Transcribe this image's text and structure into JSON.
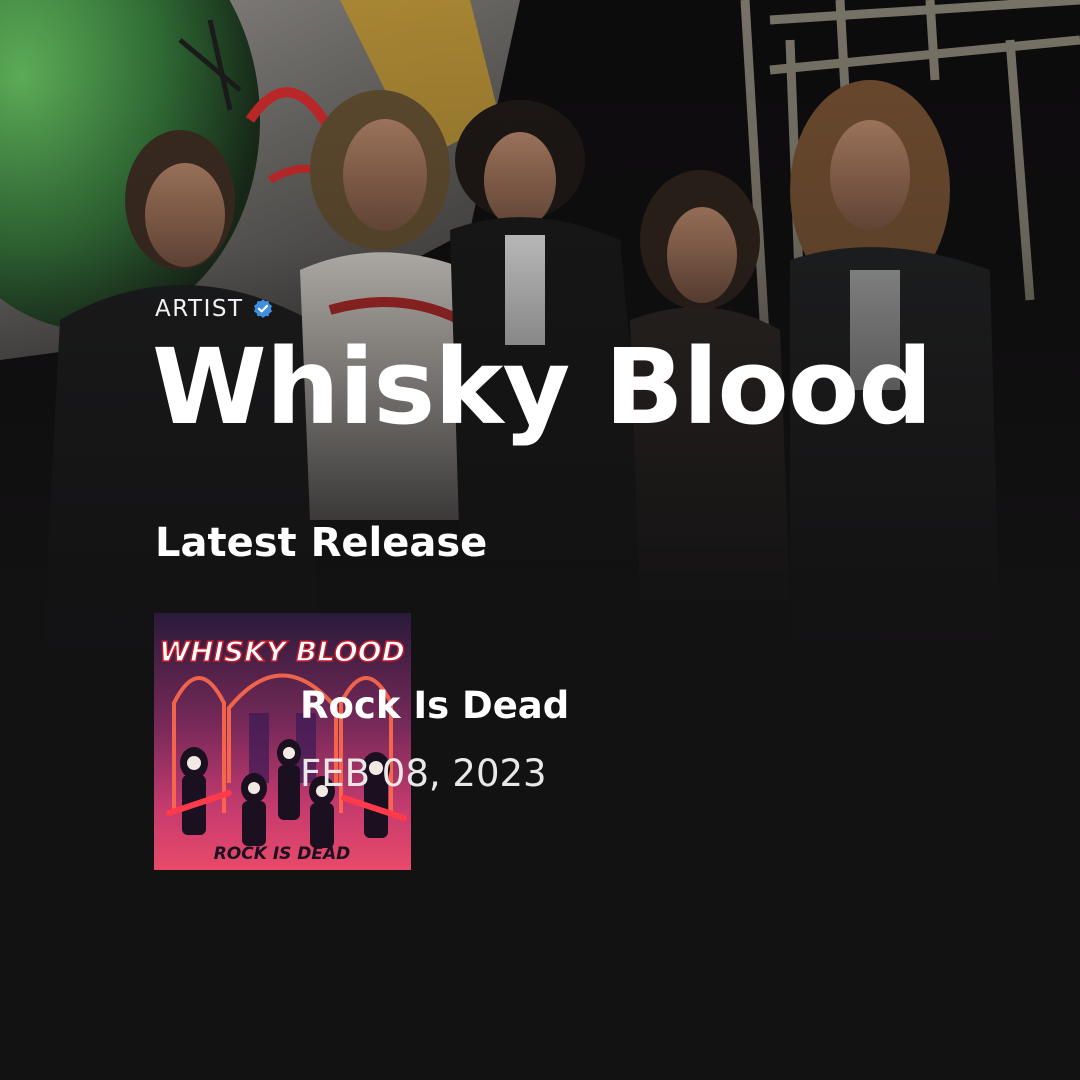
{
  "artist": {
    "type_label": "ARTIST",
    "verified_icon": "verified-check-icon",
    "name": "Whisky Blood"
  },
  "latest_release": {
    "section_title": "Latest Release",
    "title": "Rock Is Dead",
    "date": "FEB 08, 2023",
    "cover": {
      "band_logo_text": "WHISKY BLOOD",
      "album_text": "ROCK IS DEAD"
    }
  },
  "colors": {
    "background": "#131213",
    "text_primary": "#ffffff",
    "verified_badge": "#3d8fe0"
  }
}
